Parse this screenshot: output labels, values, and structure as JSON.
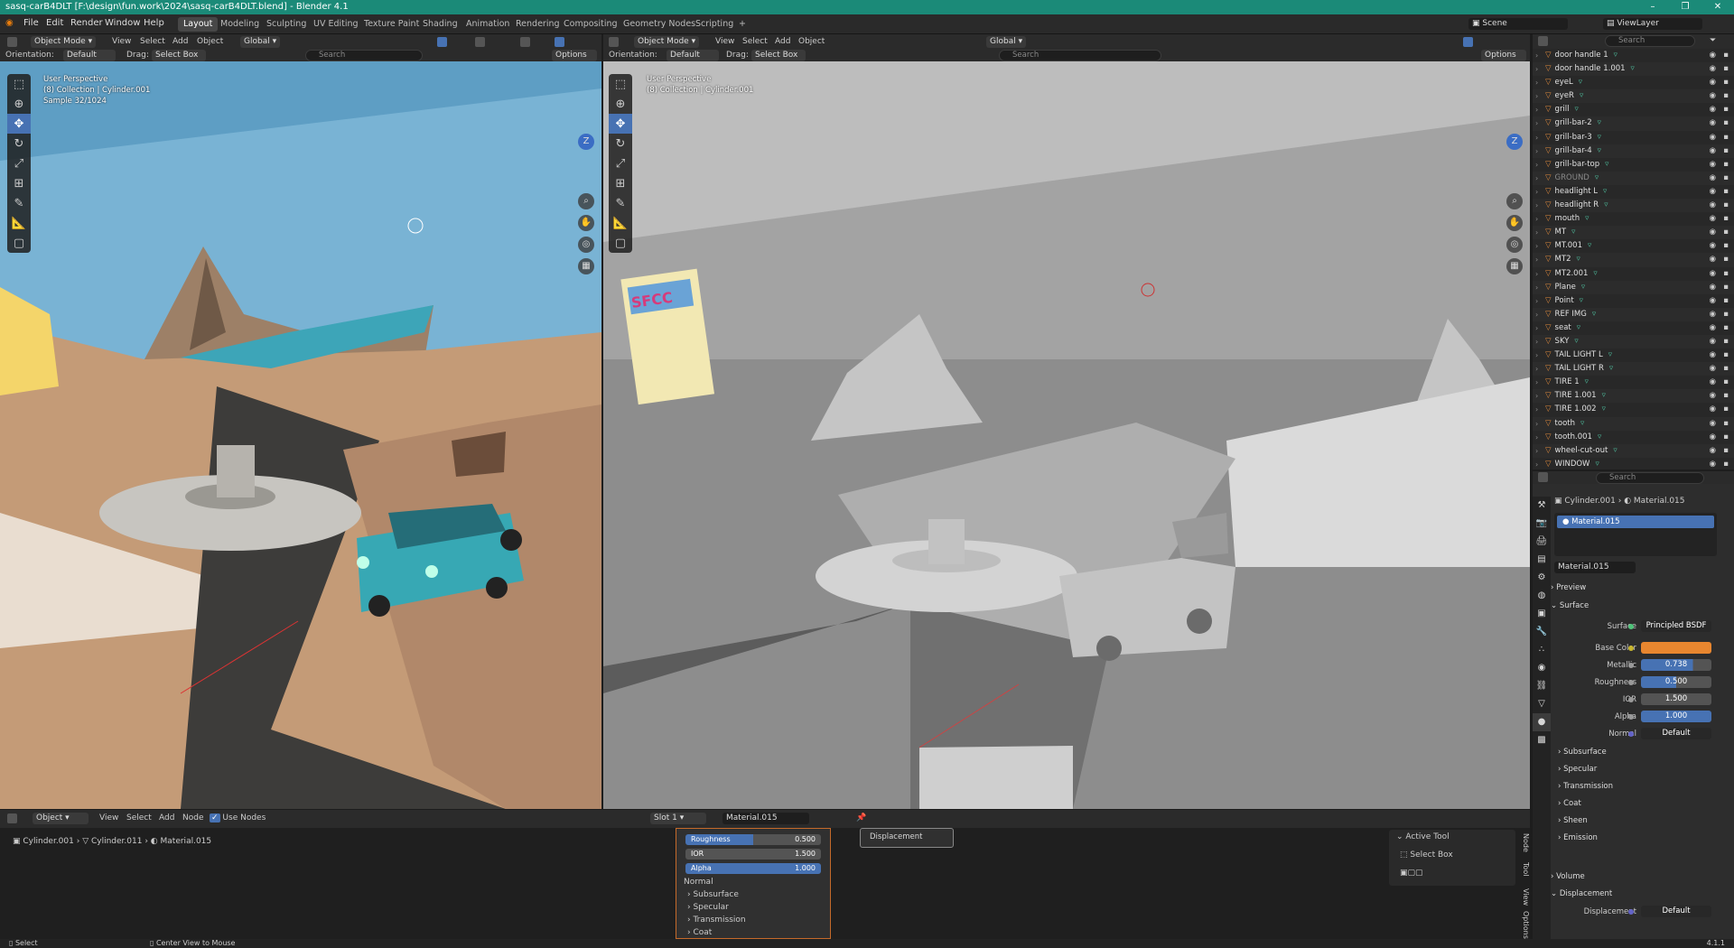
{
  "window": {
    "title": "sasq-carB4DLT [F:\\design\\fun.work\\2024\\sasq-carB4DLT.blend] - Blender 4.1",
    "minimize": "–",
    "maximize": "❐",
    "close": "✕"
  },
  "menubar": {
    "items": [
      "File",
      "Edit",
      "Render",
      "Window",
      "Help"
    ]
  },
  "workspaces": {
    "items": [
      "Layout",
      "Modeling",
      "Sculpting",
      "UV Editing",
      "Texture Paint",
      "Shading",
      "Animation",
      "Rendering",
      "Compositing",
      "Geometry Nodes",
      "Scripting"
    ],
    "active": "Layout",
    "add": "+"
  },
  "scene": {
    "scene_label": "Scene",
    "viewlayer_label": "ViewLayer"
  },
  "viewport_left": {
    "mode": "Object Mode",
    "menus": [
      "View",
      "Select",
      "Add",
      "Object"
    ],
    "transform": "Global",
    "orientation_label": "Orientation:",
    "orientation_value": "Default",
    "drag_label": "Drag:",
    "drag_value": "Select Box",
    "search_placeholder": "Search",
    "options": "Options",
    "info_line1": "User Perspective",
    "info_line2": "(8) Collection | Cylinder.001",
    "info_line3": "Sample 32/1024"
  },
  "viewport_right": {
    "mode": "Object Mode",
    "menus": [
      "View",
      "Select",
      "Add",
      "Object"
    ],
    "transform": "Global",
    "orientation_label": "Orientation:",
    "orientation_value": "Default",
    "drag_label": "Drag:",
    "drag_value": "Select Box",
    "search_placeholder": "Search",
    "options": "Options",
    "info_line1": "User Perspective",
    "info_line2": "(8) Collection | Cylinder.001",
    "poster_text": "SFCC"
  },
  "outliner": {
    "search_placeholder": "Search",
    "items": [
      {
        "name": "door handle 1",
        "dim": false
      },
      {
        "name": "door handle 1.001",
        "dim": false
      },
      {
        "name": "eyeL",
        "dim": false
      },
      {
        "name": "eyeR",
        "dim": false
      },
      {
        "name": "grill",
        "dim": false
      },
      {
        "name": "grill-bar-2",
        "dim": false
      },
      {
        "name": "grill-bar-3",
        "dim": false
      },
      {
        "name": "grill-bar-4",
        "dim": false
      },
      {
        "name": "grill-bar-top",
        "dim": false
      },
      {
        "name": "GROUND",
        "dim": true
      },
      {
        "name": "headlight L",
        "dim": false
      },
      {
        "name": "headlight R",
        "dim": false
      },
      {
        "name": "mouth",
        "dim": false
      },
      {
        "name": "MT",
        "dim": false
      },
      {
        "name": "MT.001",
        "dim": false
      },
      {
        "name": "MT2",
        "dim": false
      },
      {
        "name": "MT2.001",
        "dim": false
      },
      {
        "name": "Plane",
        "dim": false
      },
      {
        "name": "Point",
        "dim": false
      },
      {
        "name": "REF IMG",
        "dim": false
      },
      {
        "name": "seat",
        "dim": false
      },
      {
        "name": "SKY",
        "dim": false
      },
      {
        "name": "TAIL LIGHT L",
        "dim": false
      },
      {
        "name": "TAIL LIGHT R",
        "dim": false
      },
      {
        "name": "TIRE 1",
        "dim": false
      },
      {
        "name": "TIRE 1.001",
        "dim": false
      },
      {
        "name": "TIRE 1.002",
        "dim": false
      },
      {
        "name": "tooth",
        "dim": false
      },
      {
        "name": "tooth.001",
        "dim": false
      },
      {
        "name": "wheel-cut-out",
        "dim": false
      },
      {
        "name": "WINDOW",
        "dim": false
      }
    ]
  },
  "properties": {
    "search_placeholder": "Search",
    "breadcrumb_object": "Cylinder.001",
    "breadcrumb_material": "Material.015",
    "slot_material": "Material.015",
    "datablock": "Material.015",
    "preview": "Preview",
    "surface_panel": "Surface",
    "surface_label": "Surface",
    "surface_value": "Principled BSDF",
    "base_color_label": "Base Color",
    "base_color_hex": "#e8862f",
    "metallic_label": "Metallic",
    "metallic_value": "0.738",
    "metallic_fraction": 0.738,
    "roughness_label": "Roughness",
    "roughness_value": "0.500",
    "roughness_fraction": 0.5,
    "ior_label": "IOR",
    "ior_value": "1.500",
    "alpha_label": "Alpha",
    "alpha_value": "1.000",
    "alpha_fraction": 1.0,
    "normal_label": "Normal",
    "normal_value": "Default",
    "subpanels": [
      "Subsurface",
      "Specular",
      "Transmission",
      "Coat",
      "Sheen",
      "Emission"
    ],
    "volume": "Volume",
    "displacement_panel": "Displacement",
    "displacement_label": "Displacement",
    "displacement_value": "Default"
  },
  "node_editor": {
    "editor_type": "Object",
    "menus": [
      "View",
      "Select",
      "Add",
      "Node"
    ],
    "use_nodes": "Use Nodes",
    "slot": "Slot 1",
    "material": "Material.015",
    "breadcrumb": [
      "Cylinder.001",
      "Cylinder.011",
      "Material.015"
    ],
    "node_rows": [
      {
        "label": "Roughness",
        "value": "0.500",
        "fraction": 0.5
      },
      {
        "label": "IOR",
        "value": "1.500",
        "fraction": 0
      },
      {
        "label": "Alpha",
        "value": "1.000",
        "fraction": 1.0
      }
    ],
    "node_normal": "Normal",
    "node_panels": [
      "Subsurface",
      "Specular",
      "Transmission",
      "Coat"
    ],
    "output_socket": "Displacement",
    "active_tool_title": "Active Tool",
    "active_tool_name": "Select Box",
    "side_tabs": [
      "Node",
      "Tool",
      "View",
      "Options"
    ]
  },
  "statusbar": {
    "left": "Select",
    "middle": "Center View to Mouse",
    "version": "4.1.1"
  }
}
